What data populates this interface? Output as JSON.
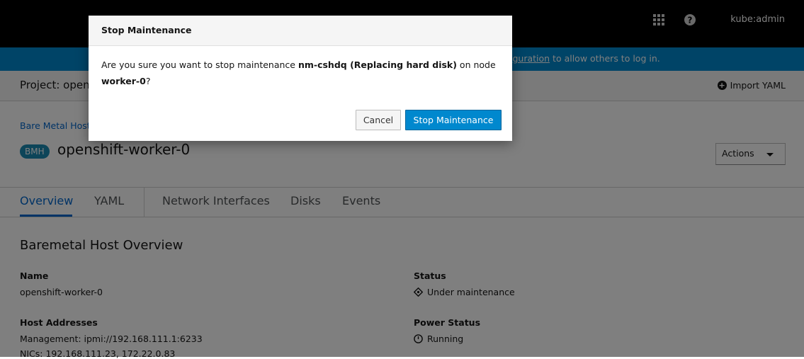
{
  "masthead": {
    "user": "kube:admin",
    "icons": [
      "grid-icon",
      "help-icon"
    ]
  },
  "banner": {
    "link_text": "iguration",
    "text_after": " to allow others to log in."
  },
  "project": {
    "label": "Project: opens",
    "import_yaml": "Import YAML"
  },
  "page": {
    "breadcrumb": "Bare Metal Host",
    "badge": "BMH",
    "title": "openshift-worker-0",
    "actions": "Actions"
  },
  "tabs": [
    {
      "label": "Overview",
      "active": true
    },
    {
      "label": "YAML"
    },
    {
      "label": "Network Interfaces"
    },
    {
      "label": "Disks"
    },
    {
      "label": "Events"
    }
  ],
  "overview": {
    "title": "Baremetal Host Overview",
    "name_label": "Name",
    "name_value": "openshift-worker-0",
    "host_addresses_label": "Host Addresses",
    "management": "Management: ipmi://192.168.111.1:6233",
    "nics": "NICs: 192.168.111.23, 172.22.0.83",
    "status_label": "Status",
    "status_value": "Under maintenance",
    "power_status_label": "Power Status",
    "power_status_value": "Running"
  },
  "modal": {
    "title": "Stop Maintenance",
    "body_prefix": "Are you sure you want to stop maintenance ",
    "maintenance_name": "nm-cshdq (Replacing hard disk)",
    "body_mid": " on node",
    "node": "worker-0",
    "body_suffix": "?",
    "cancel": "Cancel",
    "confirm": "Stop Maintenance"
  },
  "colors": {
    "accent": "#0088ce",
    "link": "#0066cc",
    "masthead": "#000000"
  }
}
